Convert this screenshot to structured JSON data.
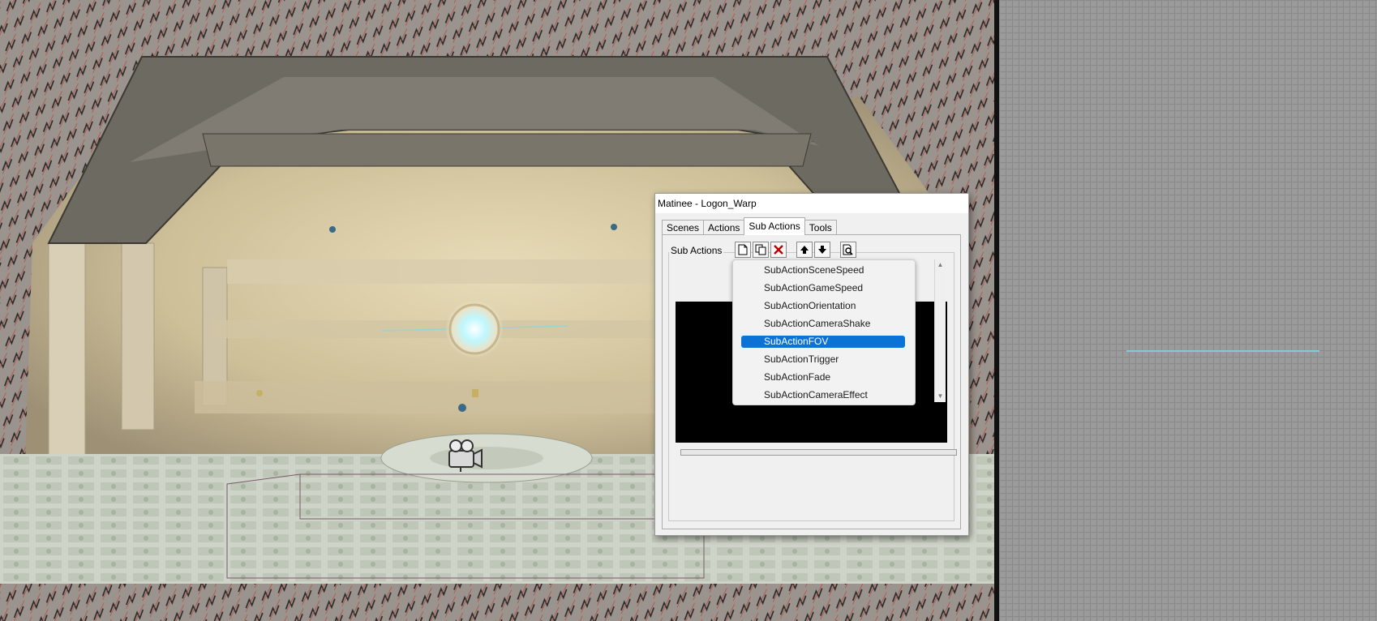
{
  "window": {
    "title": "Matinee - Logon_Warp"
  },
  "tabs": [
    {
      "label": "Scenes",
      "active": false
    },
    {
      "label": "Actions",
      "active": false
    },
    {
      "label": "Sub Actions",
      "active": true
    },
    {
      "label": "Tools",
      "active": false
    }
  ],
  "sub_actions": {
    "group_label": "Sub Actions",
    "toolbar": {
      "new_icon": "new-document-icon",
      "copy_icon": "copy-icon",
      "delete_icon": "delete-x-icon",
      "move_up_icon": "arrow-up-icon",
      "move_down_icon": "arrow-down-icon",
      "preview_icon": "magnifier-document-icon"
    }
  },
  "dropdown": {
    "items": [
      "SubActionSceneSpeed",
      "SubActionGameSpeed",
      "SubActionOrientation",
      "SubActionCameraShake",
      "SubActionFOV",
      "SubActionTrigger",
      "SubActionFade",
      "SubActionCameraEffect"
    ],
    "selected": "SubActionFOV"
  },
  "colors": {
    "selection": "#0b73d6",
    "grid_background": "#9a9a9a",
    "path_line": "#7fd7e0"
  }
}
